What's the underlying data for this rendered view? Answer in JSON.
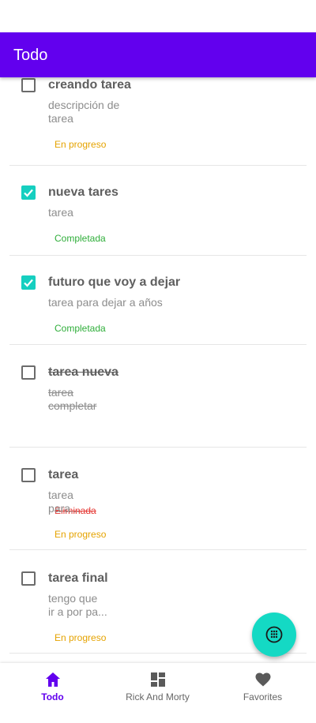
{
  "app_bar": {
    "title": "Todo"
  },
  "colors": {
    "primary": "#6200ee",
    "accent": "#14d9c4",
    "checkbox_checked": "#16cfc0",
    "status_in_progress": "#e5a300",
    "status_completed": "#2fae3a",
    "status_deleted": "#e53935"
  },
  "todos": [
    {
      "title": "creando tarea",
      "description": "descripción de\ntarea",
      "status": "En progreso",
      "checked": false
    },
    {
      "title": "nueva tares",
      "description": "tarea",
      "status": "Completada",
      "checked": true
    },
    {
      "title": "futuro que voy a dejar",
      "description": "tarea para dejar a años",
      "status": "Completada",
      "checked": true
    },
    {
      "title": "tarea nueva",
      "description": "tarea\ncompletar",
      "status": "Eliminada",
      "checked": false
    },
    {
      "title": "tarea",
      "description": "tarea\npara...",
      "status": "En progreso",
      "checked": false
    },
    {
      "title": "tarea final",
      "description": "tengo que\nir a por pa...",
      "status": "En progreso",
      "checked": false
    }
  ],
  "fab": {
    "icon": "dialpad-icon"
  },
  "bottom_nav": {
    "items": [
      {
        "label": "Todo",
        "icon": "home-icon",
        "active": true
      },
      {
        "label": "Rick And Morty",
        "icon": "dashboard-icon",
        "active": false
      },
      {
        "label": "Favorites",
        "icon": "heart-icon",
        "active": false
      }
    ]
  }
}
